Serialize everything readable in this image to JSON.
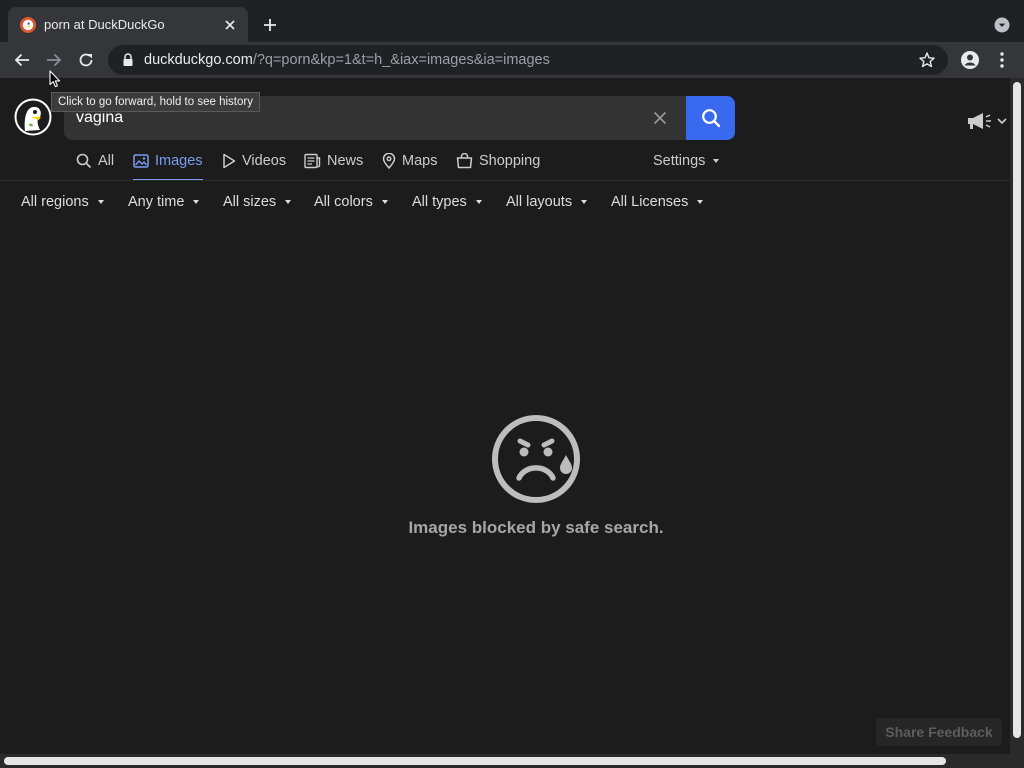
{
  "browser": {
    "tab": {
      "title": "porn at DuckDuckGo"
    },
    "url": {
      "host": "duckduckgo.com",
      "path": "/?q=porn&kp=1&t=h_&iax=images&ia=images"
    },
    "tooltip": "Click to go forward, hold to see history"
  },
  "search": {
    "query": "vagina"
  },
  "nav": {
    "tabs": [
      {
        "label": "All",
        "icon": "search-icon",
        "active": false
      },
      {
        "label": "Images",
        "icon": "image-icon",
        "active": true
      },
      {
        "label": "Videos",
        "icon": "play-icon",
        "active": false
      },
      {
        "label": "News",
        "icon": "newspaper-icon",
        "active": false
      },
      {
        "label": "Maps",
        "icon": "map-pin-icon",
        "active": false
      },
      {
        "label": "Shopping",
        "icon": "shopping-bag-icon",
        "active": false
      }
    ],
    "settings_label": "Settings"
  },
  "filters": [
    "All regions",
    "Any time",
    "All sizes",
    "All colors",
    "All types",
    "All layouts",
    "All Licenses"
  ],
  "message": {
    "icon": "sad-face-icon",
    "text": "Images blocked by safe search."
  },
  "feedback_label": "Share Feedback",
  "colors": {
    "accent": "#3969ef",
    "active_tab": "#7b9cf4",
    "background": "#1c1c1c"
  }
}
